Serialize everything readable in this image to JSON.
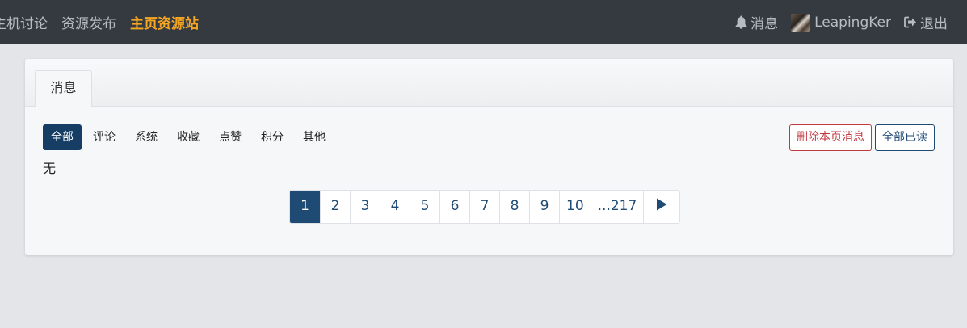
{
  "nav": {
    "left_links": [
      {
        "label": "主机讨论",
        "active": false
      },
      {
        "label": "资源发布",
        "active": false
      },
      {
        "label": "主页资源站",
        "active": true
      }
    ],
    "notifications_label": "消息",
    "username": "LeapingKer",
    "logout_label": "退出",
    "icons": {
      "notifications": "bell-icon",
      "logout": "logout-icon"
    }
  },
  "card": {
    "tab_label": "消息",
    "filters": [
      "全部",
      "评论",
      "系统",
      "收藏",
      "点赞",
      "积分",
      "其他"
    ],
    "active_filter": "全部",
    "delete_page_label": "删除本页消息",
    "mark_all_read_label": "全部已读",
    "empty_text": "无"
  },
  "pagination": {
    "pages": [
      "1",
      "2",
      "3",
      "4",
      "5",
      "6",
      "7",
      "8",
      "9",
      "10",
      "...217"
    ],
    "current": "1",
    "next_icon": "play-icon"
  },
  "colors": {
    "nav_bg": "#343a40",
    "nav_text": "#b7bcc2",
    "nav_active": "#f5a623",
    "primary": "#1e4a74",
    "danger": "#c0393f",
    "page_bg": "#e3e5e8"
  }
}
